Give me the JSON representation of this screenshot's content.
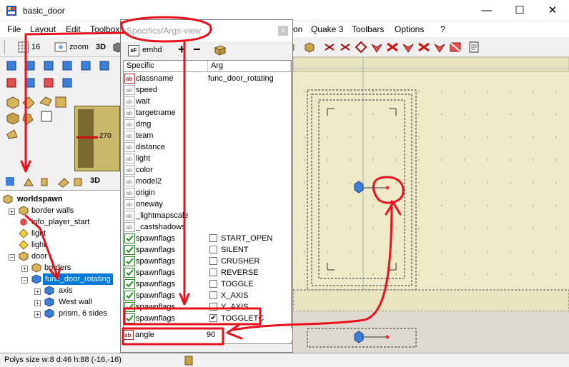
{
  "window": {
    "title": "basic_door",
    "minimize": "—",
    "maximize": "☐",
    "close": "✕"
  },
  "menu": {
    "items": [
      "File",
      "Layout",
      "Edit",
      "Toolbox",
      "on",
      "Quake 3",
      "Toolbars",
      "Options",
      "?"
    ]
  },
  "toolbar": {
    "grid_value": "16",
    "zoom_label": "zoom",
    "view3d_label": "3D"
  },
  "compass": {
    "angle": "270"
  },
  "leftpanel": {
    "view3d_label": "3D"
  },
  "tree": {
    "nodes": [
      {
        "label": "worldspawn"
      },
      {
        "label": "border walls"
      },
      {
        "label": "info_player_start"
      },
      {
        "label": "light"
      },
      {
        "label": "light"
      },
      {
        "label": "door"
      },
      {
        "label": "borders"
      },
      {
        "label": "func_door_rotating"
      },
      {
        "label": "axis"
      },
      {
        "label": "West wall"
      },
      {
        "label": "prism, 6 sides"
      }
    ]
  },
  "dialog": {
    "title": "Specifics/Args-view",
    "close": "x",
    "toolbar": {
      "sf_label": "sF",
      "emhd_label": "emhd",
      "plus": "+",
      "minus": "−"
    },
    "headers": {
      "specific": "Specific",
      "arg": "Arg"
    },
    "rows": [
      {
        "name": "classname",
        "value": "func_door_rotating",
        "type": "text"
      },
      {
        "name": "speed",
        "value": "",
        "type": "text"
      },
      {
        "name": "wait",
        "value": "",
        "type": "text"
      },
      {
        "name": "targetname",
        "value": "",
        "type": "text"
      },
      {
        "name": "dmg",
        "value": "",
        "type": "text"
      },
      {
        "name": "team",
        "value": "",
        "type": "text"
      },
      {
        "name": "distance",
        "value": "",
        "type": "text"
      },
      {
        "name": "light",
        "value": "",
        "type": "text"
      },
      {
        "name": "color",
        "value": "",
        "type": "text"
      },
      {
        "name": "model2",
        "value": "",
        "type": "text"
      },
      {
        "name": "origin",
        "value": "",
        "type": "text"
      },
      {
        "name": "oneway",
        "value": "",
        "type": "text"
      },
      {
        "name": "_lightmapscale",
        "value": "",
        "type": "text"
      },
      {
        "name": "_castshadows",
        "value": "",
        "type": "text"
      },
      {
        "name": "spawnflags",
        "flag": "START_OPEN",
        "checked": "",
        "type": "flag"
      },
      {
        "name": "spawnflags",
        "flag": "SILENT",
        "checked": "",
        "type": "flag"
      },
      {
        "name": "spawnflags",
        "flag": "CRUSHER",
        "checked": "",
        "type": "flag"
      },
      {
        "name": "spawnflags",
        "flag": "REVERSE",
        "checked": "",
        "type": "flag"
      },
      {
        "name": "spawnflags",
        "flag": "TOGGLE",
        "checked": "",
        "type": "flag"
      },
      {
        "name": "spawnflags",
        "flag": "X_AXIS",
        "checked": "",
        "type": "flag"
      },
      {
        "name": "spawnflags",
        "flag": "Y_AXIS",
        "checked": "",
        "type": "flag"
      },
      {
        "name": "spawnflags",
        "flag": "TOGGLETC",
        "checked": "✔",
        "type": "flag"
      }
    ],
    "angle": {
      "name": "angle",
      "value": "90"
    }
  },
  "status": {
    "text": "Polys size w:8 d:46 h:88 (-16,-16)"
  },
  "colors": {
    "accent_selection": "#0078d7",
    "annotation": "#e8101a",
    "view_bg": "#eeeac7"
  }
}
